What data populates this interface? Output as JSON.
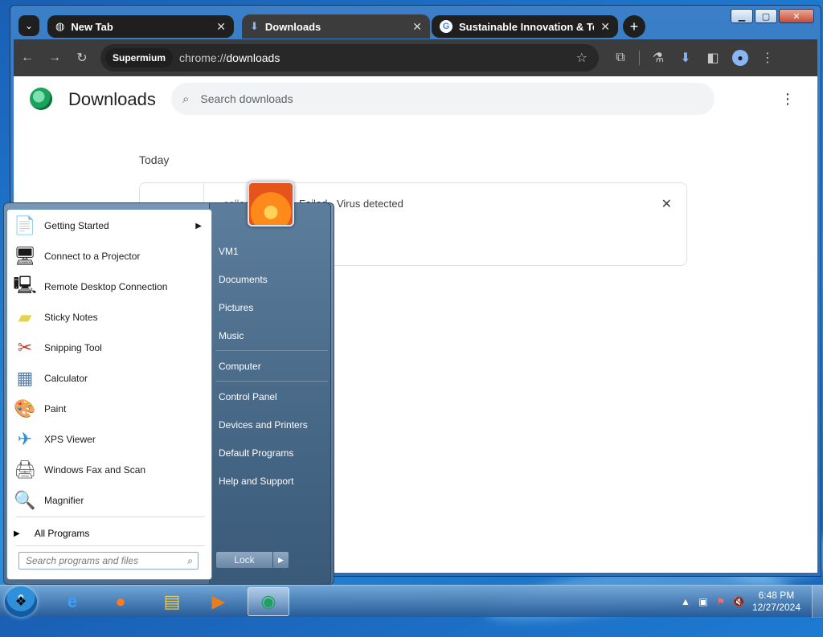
{
  "browser": {
    "tabs": [
      {
        "title": "New Tab",
        "icon": "globe-icon"
      },
      {
        "title": "Downloads",
        "icon": "download-icon"
      },
      {
        "title": "Sustainable Innovation & Techn",
        "icon": "google-icon"
      }
    ],
    "profile_chip": "Supermium",
    "url_scheme": "chrome://",
    "url_path": "downloads",
    "caption": {
      "minimize": "▁",
      "maximize": "▢",
      "close": "✕"
    }
  },
  "downloads_page": {
    "title": "Downloads",
    "search_placeholder": "Search downloads",
    "section_label": "Today",
    "items": [
      {
        "filename": "collec",
        "status": "Failed - Virus detected"
      }
    ]
  },
  "start_menu": {
    "programs": [
      {
        "label": "Getting Started",
        "icon": "getting-started-icon",
        "has_submenu": true
      },
      {
        "label": "Connect to a Projector",
        "icon": "projector-icon"
      },
      {
        "label": "Remote Desktop Connection",
        "icon": "remote-desktop-icon"
      },
      {
        "label": "Sticky Notes",
        "icon": "sticky-notes-icon"
      },
      {
        "label": "Snipping Tool",
        "icon": "snipping-tool-icon"
      },
      {
        "label": "Calculator",
        "icon": "calculator-icon"
      },
      {
        "label": "Paint",
        "icon": "paint-icon"
      },
      {
        "label": "XPS Viewer",
        "icon": "xps-viewer-icon"
      },
      {
        "label": "Windows Fax and Scan",
        "icon": "fax-scan-icon"
      },
      {
        "label": "Magnifier",
        "icon": "magnifier-icon"
      }
    ],
    "all_programs": "All Programs",
    "search_placeholder": "Search programs and files",
    "right_items": [
      "VM1",
      "Documents",
      "Pictures",
      "Music",
      "Computer",
      "Control Panel",
      "Devices and Printers",
      "Default Programs",
      "Help and Support"
    ],
    "lock_label": "Lock"
  },
  "taskbar": {
    "apps": [
      "internet-explorer-icon",
      "firefox-icon",
      "explorer-icon",
      "media-player-icon",
      "supermium-icon"
    ],
    "time": "6:48 PM",
    "date": "12/27/2024"
  }
}
